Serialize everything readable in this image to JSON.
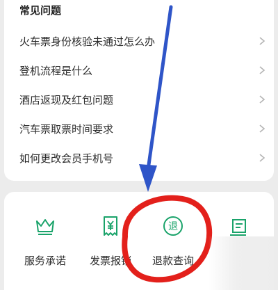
{
  "faq": {
    "title": "常见问题",
    "items": [
      {
        "label": "火车票身份核验未通过怎么办"
      },
      {
        "label": "登机流程是什么"
      },
      {
        "label": "酒店返现及红包问题"
      },
      {
        "label": "汽车票取票时间要求"
      },
      {
        "label": "如何更改会员手机号"
      }
    ]
  },
  "services": {
    "items": [
      {
        "label": "服务承诺",
        "icon": "crown-icon"
      },
      {
        "label": "发票报销",
        "icon": "receipt-icon"
      },
      {
        "label": "退款查询",
        "icon": "refund-icon",
        "icon_text": "退"
      },
      {
        "label": "",
        "icon": "edit-document-icon"
      }
    ]
  },
  "colors": {
    "accent_green": "#1aa36a",
    "annotation_red": "#e3201b",
    "annotation_blue": "#2f55c8"
  }
}
